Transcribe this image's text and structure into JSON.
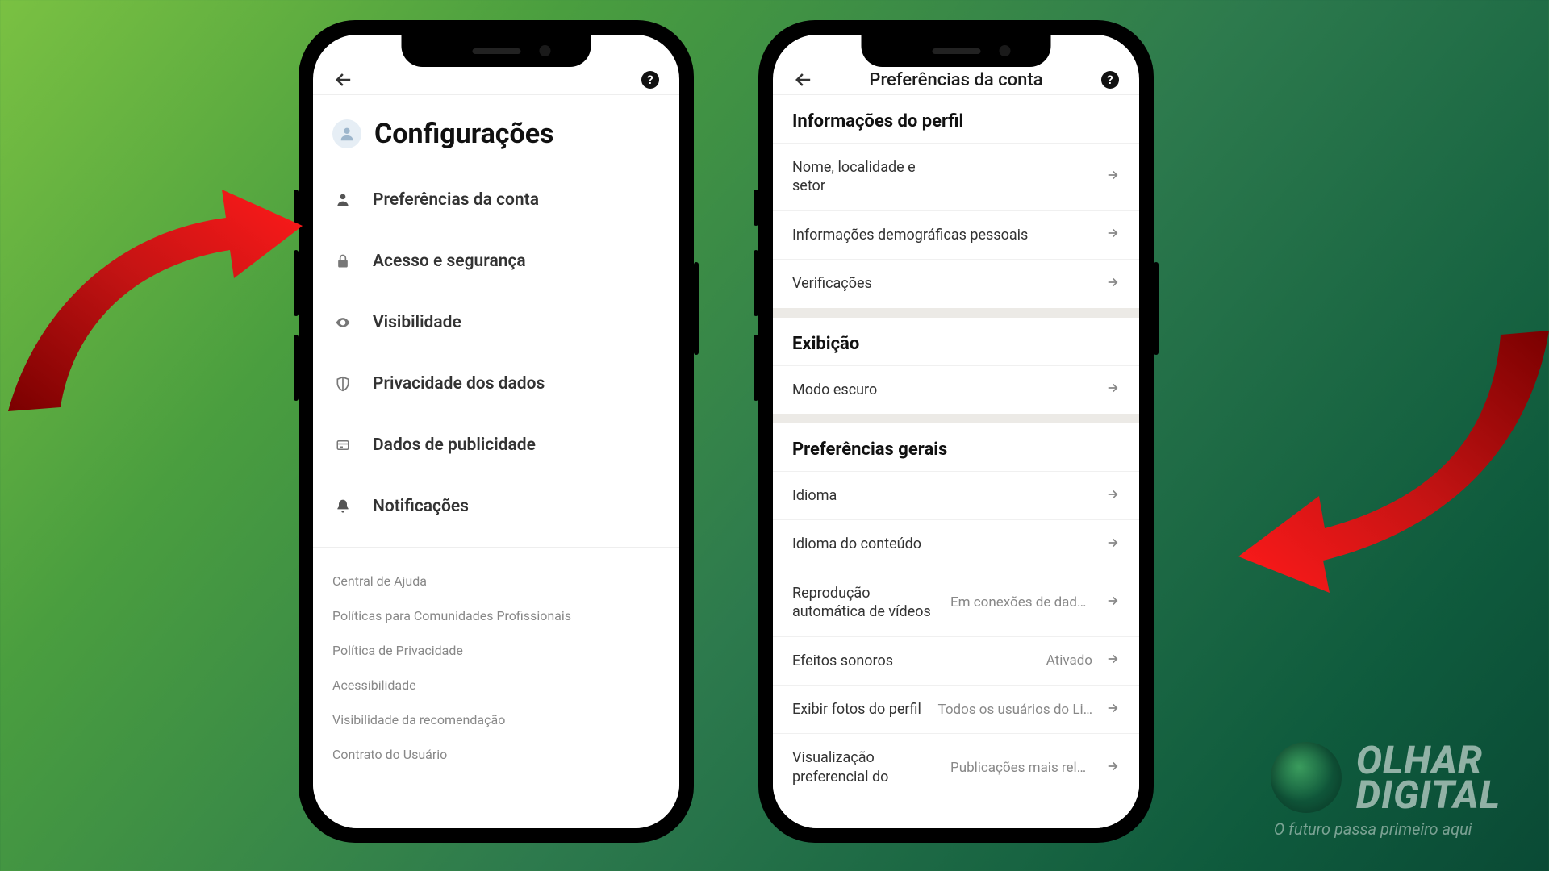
{
  "brand": {
    "name_line1": "OLHAR",
    "name_line2": "DIGITAL",
    "tagline": "O futuro passa primeiro aqui"
  },
  "phone1": {
    "header": {
      "title": "Configurações"
    },
    "categories": [
      {
        "icon": "person",
        "label": "Preferências da conta"
      },
      {
        "icon": "lock",
        "label": "Acesso e segurança"
      },
      {
        "icon": "eye",
        "label": "Visibilidade"
      },
      {
        "icon": "shield",
        "label": "Privacidade dos dados"
      },
      {
        "icon": "card",
        "label": "Dados de publicidade"
      },
      {
        "icon": "bell",
        "label": "Notificações"
      }
    ],
    "links": [
      "Central de Ajuda",
      "Políticas para Comunidades Profissionais",
      "Política de Privacidade",
      "Acessibilidade",
      "Visibilidade da recomendação",
      "Contrato do Usuário"
    ]
  },
  "phone2": {
    "header": {
      "title": "Preferências da conta"
    },
    "sections": [
      {
        "title": "Informações do perfil",
        "rows": [
          {
            "label": "Nome, localidade e setor",
            "value": ""
          },
          {
            "label": "Informações demográficas pessoais",
            "value": ""
          },
          {
            "label": "Verificações",
            "value": ""
          }
        ]
      },
      {
        "title": "Exibição",
        "rows": [
          {
            "label": "Modo escuro",
            "value": ""
          }
        ]
      },
      {
        "title": "Preferências gerais",
        "rows": [
          {
            "label": "Idioma",
            "value": ""
          },
          {
            "label": "Idioma do conteúdo",
            "value": ""
          },
          {
            "label": "Reprodução automática de vídeos",
            "value": "Em conexões de dados …"
          },
          {
            "label": "Efeitos sonoros",
            "value": "Ativado"
          },
          {
            "label": "Exibir fotos do perfil",
            "value": "Todos os usuários do Li…"
          },
          {
            "label": "Visualização preferencial do",
            "value": "Publicações mais relev…"
          }
        ]
      }
    ]
  }
}
